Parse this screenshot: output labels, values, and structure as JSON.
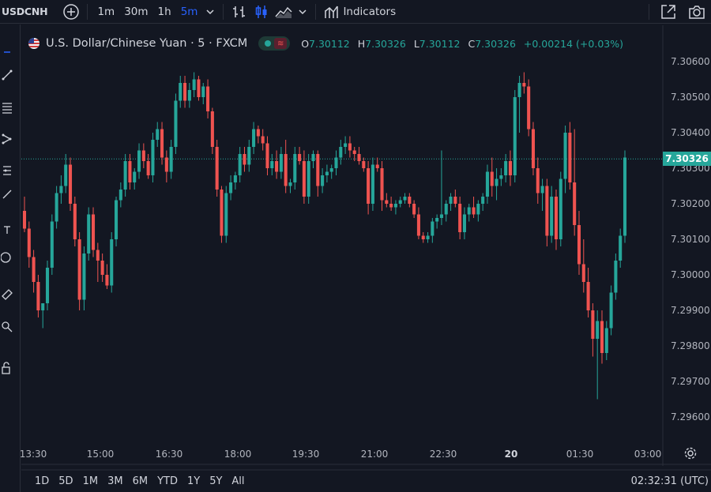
{
  "toolbar": {
    "symbol": "USDCNH",
    "intervals": [
      "1m",
      "30m",
      "1h",
      "5m"
    ],
    "active_interval": "5m",
    "indicators_label": "Indicators"
  },
  "legend": {
    "title": "U.S. Dollar/Chinese Yuan · 5 · FXCM",
    "open_label": "O",
    "open": "7.30112",
    "high_label": "H",
    "high": "7.30326",
    "low_label": "L",
    "low": "7.30112",
    "close_label": "C",
    "close": "7.30326",
    "change": "+0.00214 (+0.03%)"
  },
  "current_price": "7.30326",
  "time_range_buttons": [
    "1D",
    "5D",
    "1M",
    "3M",
    "6M",
    "YTD",
    "1Y",
    "5Y",
    "All"
  ],
  "clock": "02:32:31 (UTC)",
  "colors": {
    "up": "#26a69a",
    "down": "#ef5350",
    "background": "#131722",
    "accent": "#2962ff"
  },
  "chart_data": {
    "type": "candlestick",
    "title": "U.S. Dollar/Chinese Yuan · 5 · FXCM",
    "y_ticks": [
      "7.30600",
      "7.30500",
      "7.30400",
      "7.30300",
      "7.30200",
      "7.30100",
      "7.30000",
      "7.29900",
      "7.29800",
      "7.29700",
      "7.29600"
    ],
    "x_ticks": [
      "13:30",
      "15:00",
      "16:30",
      "18:00",
      "19:30",
      "21:00",
      "22:30",
      "20",
      "01:30",
      "03:00"
    ],
    "ylim": [
      7.2957,
      7.3066
    ],
    "current_price": 7.30326,
    "candles_ohlc": [
      [
        7.3018,
        7.3022,
        7.3012,
        7.3013
      ],
      [
        7.3013,
        7.3015,
        7.3002,
        7.3005
      ],
      [
        7.3005,
        7.3007,
        7.2995,
        7.2998
      ],
      [
        7.2998,
        7.3,
        7.2988,
        7.299
      ],
      [
        7.299,
        7.2992,
        7.2985,
        7.2992
      ],
      [
        7.2992,
        7.3004,
        7.299,
        7.3002
      ],
      [
        7.3002,
        7.3017,
        7.3,
        7.3015
      ],
      [
        7.3015,
        7.3025,
        7.3013,
        7.3023
      ],
      [
        7.3023,
        7.3028,
        7.302,
        7.3025
      ],
      [
        7.3025,
        7.3034,
        7.3023,
        7.3031
      ],
      [
        7.3031,
        7.3033,
        7.3018,
        7.302
      ],
      [
        7.302,
        7.3022,
        7.3008,
        7.301
      ],
      [
        7.301,
        7.3012,
        7.299,
        7.2993
      ],
      [
        7.2993,
        7.3008,
        7.299,
        7.3006
      ],
      [
        7.3006,
        7.3019,
        7.3004,
        7.3017
      ],
      [
        7.3017,
        7.3019,
        7.3005,
        7.3007
      ],
      [
        7.3007,
        7.3009,
        7.2998,
        7.3004
      ],
      [
        7.3004,
        7.3006,
        7.2998,
        7.3
      ],
      [
        7.3,
        7.3003,
        7.2996,
        7.2997
      ],
      [
        7.2997,
        7.3012,
        7.2995,
        7.301
      ],
      [
        7.301,
        7.3022,
        7.3008,
        7.3021
      ],
      [
        7.3021,
        7.3026,
        7.3019,
        7.3024
      ],
      [
        7.3024,
        7.3034,
        7.3022,
        7.3032
      ],
      [
        7.3032,
        7.3034,
        7.3024,
        7.3026
      ],
      [
        7.3026,
        7.303,
        7.3024,
        7.3029
      ],
      [
        7.3029,
        7.3037,
        7.3027,
        7.3035
      ],
      [
        7.3035,
        7.3037,
        7.303,
        7.3032
      ],
      [
        7.3032,
        7.3034,
        7.3027,
        7.3028
      ],
      [
        7.3028,
        7.304,
        7.3026,
        7.3038
      ],
      [
        7.3038,
        7.3043,
        7.3036,
        7.3041
      ],
      [
        7.3041,
        7.3043,
        7.3031,
        7.3033
      ],
      [
        7.3033,
        7.3035,
        7.3026,
        7.3029
      ],
      [
        7.3029,
        7.3038,
        7.3027,
        7.3036
      ],
      [
        7.3036,
        7.3051,
        7.3034,
        7.3049
      ],
      [
        7.3049,
        7.3056,
        7.3047,
        7.3054
      ],
      [
        7.3054,
        7.3056,
        7.3047,
        7.3049
      ],
      [
        7.3049,
        7.3054,
        7.3047,
        7.3052
      ],
      [
        7.3052,
        7.3057,
        7.305,
        7.3055
      ],
      [
        7.3055,
        7.3056,
        7.3049,
        7.305
      ],
      [
        7.305,
        7.3054,
        7.3048,
        7.3053
      ],
      [
        7.3053,
        7.3055,
        7.3044,
        7.3046
      ],
      [
        7.3046,
        7.3047,
        7.3034,
        7.3036
      ],
      [
        7.3036,
        7.3038,
        7.3022,
        7.3024
      ],
      [
        7.3024,
        7.3025,
        7.3009,
        7.3011
      ],
      [
        7.3011,
        7.3025,
        7.3009,
        7.3023
      ],
      [
        7.3023,
        7.3028,
        7.3021,
        7.3026
      ],
      [
        7.3026,
        7.3029,
        7.3024,
        7.3028
      ],
      [
        7.3028,
        7.3036,
        7.3026,
        7.3034
      ],
      [
        7.3034,
        7.3036,
        7.3029,
        7.3031
      ],
      [
        7.3031,
        7.3038,
        7.3029,
        7.3036
      ],
      [
        7.3036,
        7.3043,
        7.3034,
        7.3041
      ],
      [
        7.3041,
        7.3042,
        7.3037,
        7.3039
      ],
      [
        7.3039,
        7.3041,
        7.3035,
        7.3037
      ],
      [
        7.3037,
        7.3039,
        7.3028,
        7.303
      ],
      [
        7.303,
        7.3034,
        7.3028,
        7.3032
      ],
      [
        7.3032,
        7.3035,
        7.3027,
        7.3029
      ],
      [
        7.3029,
        7.3036,
        7.3027,
        7.3034
      ],
      [
        7.3034,
        7.3038,
        7.3023,
        7.3025
      ],
      [
        7.3025,
        7.3027,
        7.3023,
        7.3026
      ],
      [
        7.3026,
        7.3036,
        7.3024,
        7.3034
      ],
      [
        7.3034,
        7.3036,
        7.3031,
        7.3032
      ],
      [
        7.3032,
        7.3035,
        7.302,
        7.3022
      ],
      [
        7.3022,
        7.3034,
        7.302,
        7.3032
      ],
      [
        7.3032,
        7.3035,
        7.303,
        7.3034
      ],
      [
        7.3034,
        7.3035,
        7.3022,
        7.3025
      ],
      [
        7.3025,
        7.303,
        7.3023,
        7.3028
      ],
      [
        7.3028,
        7.3031,
        7.3026,
        7.3029
      ],
      [
        7.3029,
        7.3031,
        7.3027,
        7.303
      ],
      [
        7.303,
        7.3035,
        7.3028,
        7.3033
      ],
      [
        7.3033,
        7.3038,
        7.3031,
        7.3036
      ],
      [
        7.3036,
        7.3039,
        7.3034,
        7.3037
      ],
      [
        7.3037,
        7.3039,
        7.3033,
        7.3035
      ],
      [
        7.3035,
        7.3036,
        7.3032,
        7.3034
      ],
      [
        7.3034,
        7.3036,
        7.3031,
        7.3032
      ],
      [
        7.3032,
        7.3033,
        7.3029,
        7.303
      ],
      [
        7.303,
        7.3032,
        7.3017,
        7.302
      ],
      [
        7.302,
        7.3033,
        7.3018,
        7.3031
      ],
      [
        7.3031,
        7.3033,
        7.3029,
        7.303
      ],
      [
        7.303,
        7.3032,
        7.3018,
        7.3021
      ],
      [
        7.3021,
        7.3023,
        7.3019,
        7.302
      ],
      [
        7.302,
        7.3022,
        7.3018,
        7.3019
      ],
      [
        7.3019,
        7.3021,
        7.3017,
        7.302
      ],
      [
        7.302,
        7.3022,
        7.3019,
        7.3021
      ],
      [
        7.3021,
        7.3023,
        7.302,
        7.3022
      ],
      [
        7.3022,
        7.3023,
        7.3019,
        7.302
      ],
      [
        7.302,
        7.3021,
        7.3016,
        7.3017
      ],
      [
        7.3017,
        7.3019,
        7.301,
        7.3011
      ],
      [
        7.3011,
        7.3012,
        7.3009,
        7.301
      ],
      [
        7.301,
        7.3012,
        7.3009,
        7.3011
      ],
      [
        7.3011,
        7.3016,
        7.3009,
        7.3015
      ],
      [
        7.3015,
        7.3017,
        7.3013,
        7.3016
      ],
      [
        7.3016,
        7.3035,
        7.3014,
        7.3017
      ],
      [
        7.3017,
        7.3021,
        7.3015,
        7.302
      ],
      [
        7.302,
        7.3023,
        7.3018,
        7.3022
      ],
      [
        7.3022,
        7.3024,
        7.3019,
        7.302
      ],
      [
        7.302,
        7.3022,
        7.301,
        7.3012
      ],
      [
        7.3012,
        7.3019,
        7.301,
        7.3017
      ],
      [
        7.3017,
        7.302,
        7.3015,
        7.3019
      ],
      [
        7.3019,
        7.3022,
        7.3016,
        7.3017
      ],
      [
        7.3017,
        7.3021,
        7.3015,
        7.302
      ],
      [
        7.302,
        7.3023,
        7.3018,
        7.3022
      ],
      [
        7.3022,
        7.3031,
        7.302,
        7.3029
      ],
      [
        7.3029,
        7.3033,
        7.3022,
        7.3025
      ],
      [
        7.3025,
        7.303,
        7.3021,
        7.3027
      ],
      [
        7.3027,
        7.303,
        7.3025,
        7.3028
      ],
      [
        7.3028,
        7.3034,
        7.3026,
        7.3032
      ],
      [
        7.3032,
        7.3035,
        7.3025,
        7.3028
      ],
      [
        7.3028,
        7.3052,
        7.3026,
        7.305
      ],
      [
        7.305,
        7.3056,
        7.304,
        7.3054
      ],
      [
        7.3054,
        7.3057,
        7.3051,
        7.3053
      ],
      [
        7.3053,
        7.3055,
        7.3039,
        7.3041
      ],
      [
        7.3041,
        7.3043,
        7.3028,
        7.303
      ],
      [
        7.303,
        7.3033,
        7.302,
        7.3023
      ],
      [
        7.3023,
        7.3027,
        7.3018,
        7.3025
      ],
      [
        7.3025,
        7.3027,
        7.3008,
        7.3011
      ],
      [
        7.3011,
        7.3025,
        7.3009,
        7.3022
      ],
      [
        7.3022,
        7.3024,
        7.3007,
        7.301
      ],
      [
        7.301,
        7.3029,
        7.3008,
        7.3027
      ],
      [
        7.3027,
        7.3042,
        7.3023,
        7.304
      ],
      [
        7.304,
        7.3043,
        7.3024,
        7.3026
      ],
      [
        7.3026,
        7.3041,
        7.3011,
        7.3014
      ],
      [
        7.3014,
        7.3018,
        7.3,
        7.3003
      ],
      [
        7.3003,
        7.301,
        7.2995,
        7.2998
      ],
      [
        7.2998,
        7.3002,
        7.2988,
        7.299
      ],
      [
        7.299,
        7.2992,
        7.2977,
        7.2982
      ],
      [
        7.2982,
        7.299,
        7.2965,
        7.2987
      ],
      [
        7.2987,
        7.299,
        7.2975,
        7.2978
      ],
      [
        7.2978,
        7.2987,
        7.2976,
        7.2985
      ],
      [
        7.2985,
        7.2997,
        7.2983,
        7.2995
      ],
      [
        7.2995,
        7.3006,
        7.2993,
        7.3004
      ],
      [
        7.3004,
        7.3013,
        7.3002,
        7.3011
      ],
      [
        7.3011,
        7.3035,
        7.3009,
        7.3033
      ]
    ]
  }
}
